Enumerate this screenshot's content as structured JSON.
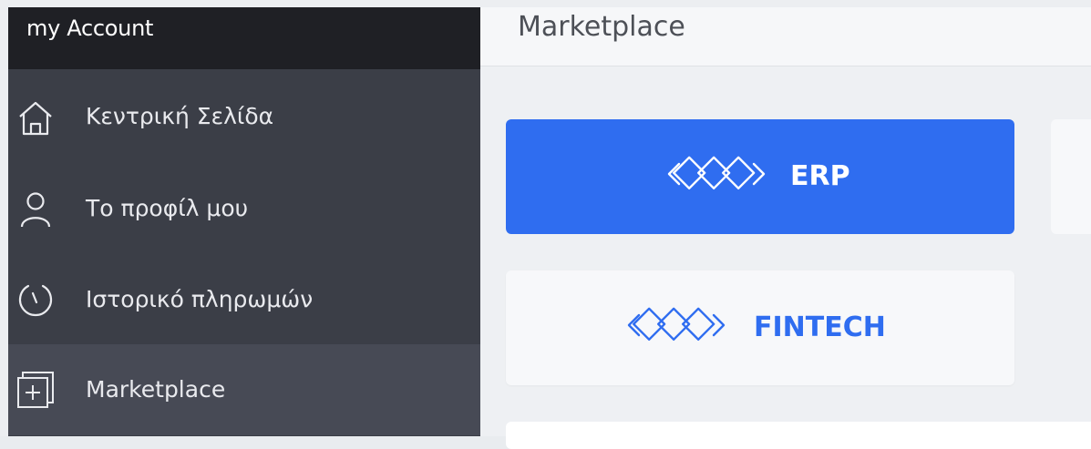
{
  "sidebar": {
    "account_title": "my Account",
    "items": [
      {
        "label": "Κεντρική Σελίδα",
        "icon": "home-icon",
        "active": false
      },
      {
        "label": "Το προφίλ μου",
        "icon": "user-icon",
        "active": false
      },
      {
        "label": "Ιστορικό πληρωμών",
        "icon": "clock-icon",
        "active": false
      },
      {
        "label": "Marketplace",
        "icon": "marketplace-icon",
        "active": true
      }
    ]
  },
  "main": {
    "title": "Marketplace",
    "cards": [
      {
        "label": "ERP",
        "icon": "chain-logo-icon",
        "selected": true
      },
      {
        "label": "FINTECH",
        "icon": "chain-logo-icon",
        "selected": false
      }
    ]
  },
  "colors": {
    "accent": "#2f6df0",
    "sidebar_bg": "#3b3e47",
    "sidebar_header_bg": "#1f2025",
    "sidebar_active_bg": "#474a55"
  }
}
